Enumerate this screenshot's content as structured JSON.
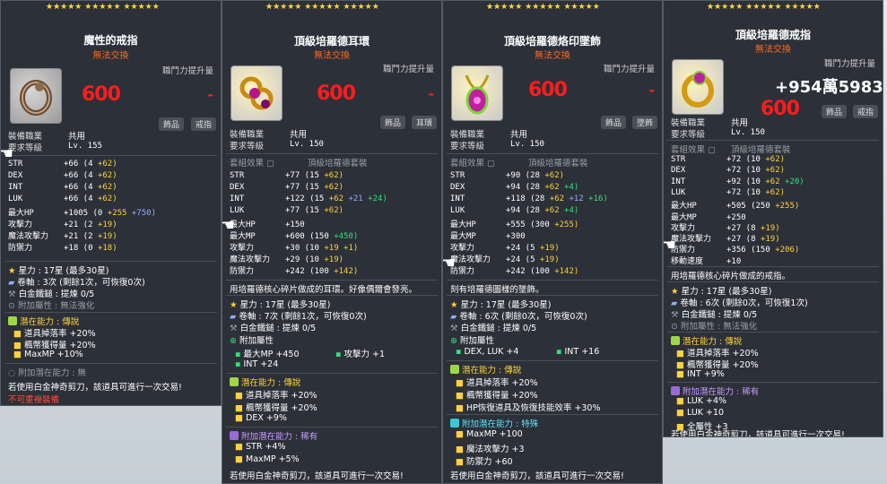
{
  "star_rows": [
    "★★★★★  ★★★★★  ★★★★★",
    "★★☆☆☆"
  ],
  "cards": [
    {
      "name": "魔性的戒指",
      "untradeable": "無法交換",
      "upgrade_label": "職鬥力提升量",
      "value": "600",
      "dash": "-",
      "tags": [
        "飾品",
        "戒指"
      ],
      "job_label": "裝備職業",
      "job_value": "共用",
      "level_label": "要求等級",
      "level_value": "Lv. 155",
      "stats": [
        {
          "k": "STR",
          "v": "+66 (4",
          "a": "+62)"
        },
        {
          "k": "DEX",
          "v": "+66 (4",
          "a": "+62)"
        },
        {
          "k": "INT",
          "v": "+66 (4",
          "a": "+62)"
        },
        {
          "k": "LUK",
          "v": "+66 (4",
          "a": "+62)"
        },
        {
          "k": "最大HP",
          "v": "+1005 (0",
          "a": "+255",
          "b": "+750)"
        },
        {
          "k": "攻擊力",
          "v": "+21 (2",
          "a": "+19)"
        },
        {
          "k": "魔法攻擊力",
          "v": "+21 (2",
          "a": "+19)"
        },
        {
          "k": "防禦力",
          "v": "+18 (0",
          "a": "+18)"
        }
      ],
      "starforce": "星力 : 17星 (最多30星)",
      "scroll": "卷軸 : 3次 (剩餘1次，可恢復0次)",
      "hammer": "白金鐵鎚 : 提煉 0/5",
      "addopt": "附加屬性 : 無法強化",
      "pot_title": "潛在能力 : 傳說",
      "pot": [
        "道具掉落率 +20%",
        "楓幣獲得量 +20%",
        "MaxMP +10%"
      ],
      "addpot_title": "附加潛在能力 : 無",
      "scissors": "若使用白金神奇剪刀，該道具可進行一次交易!",
      "reequip": "不可重複裝備"
    },
    {
      "name": "頂級培羅德耳環",
      "untradeable": "無法交換",
      "upgrade_label": "職鬥力提升量",
      "value": "600",
      "dash": "-",
      "tags": [
        "飾品",
        "耳環"
      ],
      "job_label": "裝備職業",
      "job_value": "共用",
      "level_label": "要求等級",
      "level_value": "Lv. 150",
      "set_label": "套組效果",
      "set_value": "頂級培羅德套裝",
      "stats": [
        {
          "k": "STR",
          "v": "+77 (15",
          "a": "+62)"
        },
        {
          "k": "DEX",
          "v": "+77 (15",
          "a": "+62)"
        },
        {
          "k": "INT",
          "v": "+122 (15",
          "a": "+62",
          "b": "+21",
          "c": "+24)"
        },
        {
          "k": "LUK",
          "v": "+77 (15",
          "a": "+62)"
        },
        {
          "k": "最大HP",
          "v": "+150"
        },
        {
          "k": "最大MP",
          "v": "+600 (150",
          "c": "+450)"
        },
        {
          "k": "攻擊力",
          "v": "+30 (10",
          "a": "+19",
          "c2": "+1)"
        },
        {
          "k": "魔法攻擊力",
          "v": "+29 (10",
          "a": "+19)"
        },
        {
          "k": "防禦力",
          "v": "+242 (100",
          "a": "+142)"
        }
      ],
      "desc": "用培羅德核心碎片做成的耳環。好像偶爾會發亮。",
      "starforce": "星力 : 17星 (最多30星)",
      "scroll": "卷軸 : 7次 (剩餘1次，可恢復0次)",
      "hammer": "白金鐵鎚 : 提煉 0/5",
      "addopt_title": "附加屬性",
      "addopts": [
        "最大MP +450",
        "攻擊力 +1",
        "INT +24"
      ],
      "pot_title": "潛在能力 : 傳說",
      "pot": [
        "道具掉落率 +20%",
        "楓幣獲得量 +20%",
        "DEX +9%"
      ],
      "addpot_title": "附加潛在能力 : 稀有",
      "addpot": [
        "STR +4%",
        "MaxMP +5%"
      ],
      "scissors": "若使用白金神奇剪刀，該道具可進行一次交易!"
    },
    {
      "name": "頂級培羅德烙印墜飾",
      "untradeable": "無法交換",
      "upgrade_label": "職鬥力提升量",
      "value": "600",
      "dash": "-",
      "tags": [
        "飾品",
        "墜飾"
      ],
      "job_label": "裝備職業",
      "job_value": "共用",
      "level_label": "要求等級",
      "level_value": "Lv. 150",
      "set_label": "套組效果",
      "set_value": "頂級培羅德套裝",
      "stats": [
        {
          "k": "STR",
          "v": "+90 (28",
          "a": "+62)"
        },
        {
          "k": "DEX",
          "v": "+94 (28",
          "a": "+62",
          "c": "+4)"
        },
        {
          "k": "INT",
          "v": "+118 (28",
          "a": "+62",
          "b": "+12",
          "c": "+16)"
        },
        {
          "k": "LUK",
          "v": "+94 (28",
          "a": "+62",
          "c": "+4)"
        },
        {
          "k": "最大HP",
          "v": "+555 (300",
          "a": "+255)"
        },
        {
          "k": "最大MP",
          "v": "+300"
        },
        {
          "k": "攻擊力",
          "v": "+24 (5",
          "a": "+19)"
        },
        {
          "k": "魔法攻擊力",
          "v": "+24 (5",
          "a": "+19)"
        },
        {
          "k": "防禦力",
          "v": "+242 (100",
          "a": "+142)"
        }
      ],
      "desc": "刻有培羅德圖樣的墜飾。",
      "starforce": "星力 : 17星 (最多30星)",
      "scroll": "卷軸 : 6次 (剩餘0次，可恢復0次)",
      "hammer": "白金鐵鎚 : 提煉 0/5",
      "addopt_title": "附加屬性",
      "addopts": [
        "DEX, LUK +4",
        "INT +16"
      ],
      "pot_title": "潛在能力 : 傳說",
      "pot": [
        "道具掉落率 +20%",
        "楓幣獲得量 +20%",
        "HP恢復道具及恢復技能效率 +30%"
      ],
      "addpot_title": "附加潛在能力 : 特殊",
      "addpot": [
        "MaxMP +100",
        "魔法攻擊力 +3",
        "防禦力 +60"
      ],
      "scissors": "若使用白金神奇剪刀，該道具可進行一次交易!"
    },
    {
      "name": "頂級培羅德戒指",
      "untradeable": "無法交換",
      "upgrade_label": "職鬥力提升量",
      "huge": "+954萬5983",
      "value": "600",
      "tags": [
        "飾品",
        "戒指"
      ],
      "job_label": "裝備職業",
      "job_value": "共用",
      "level_label": "要求等級",
      "level_value": "Lv. 150",
      "set_label": "套組效果",
      "set_value": "頂級培羅德套裝",
      "stats": [
        {
          "k": "STR",
          "v": "+72 (10",
          "a": "+62)"
        },
        {
          "k": "DEX",
          "v": "+72 (10",
          "a": "+62)"
        },
        {
          "k": "INT",
          "v": "+92 (10",
          "a": "+62",
          "c": "+20)"
        },
        {
          "k": "LUK",
          "v": "+72 (10",
          "a": "+62)"
        },
        {
          "k": "最大HP",
          "v": "+505 (250",
          "a": "+255)"
        },
        {
          "k": "最大MP",
          "v": "+250"
        },
        {
          "k": "攻擊力",
          "v": "+27 (8",
          "a": "+19)"
        },
        {
          "k": "魔法攻擊力",
          "v": "+27 (8",
          "a": "+19)"
        },
        {
          "k": "防禦力",
          "v": "+356 (150",
          "a": "+206)"
        },
        {
          "k": "移動速度",
          "v": "+10"
        }
      ],
      "desc": "用培羅德核心碎片做成的戒指。",
      "starforce": "星力 : 17星 (最多30星)",
      "scroll": "卷軸 : 6次 (剩餘0次，可恢復1次)",
      "hammer": "白金鐵鎚 : 提煉 0/5",
      "addopt": "附加屬性 : 無法強化",
      "pot_title": "潛在能力 : 傳說",
      "pot": [
        "道具掉落率 +20%",
        "楓幣獲得量 +20%",
        "INT +9%"
      ],
      "addpot_title": "附加潛在能力 : 稀有",
      "addpot": [
        "LUK +4%",
        "LUK +10",
        "全屬性 +3"
      ],
      "scissors": "若使用白金神奇剪刀，該道具可進行一次交易!"
    }
  ]
}
